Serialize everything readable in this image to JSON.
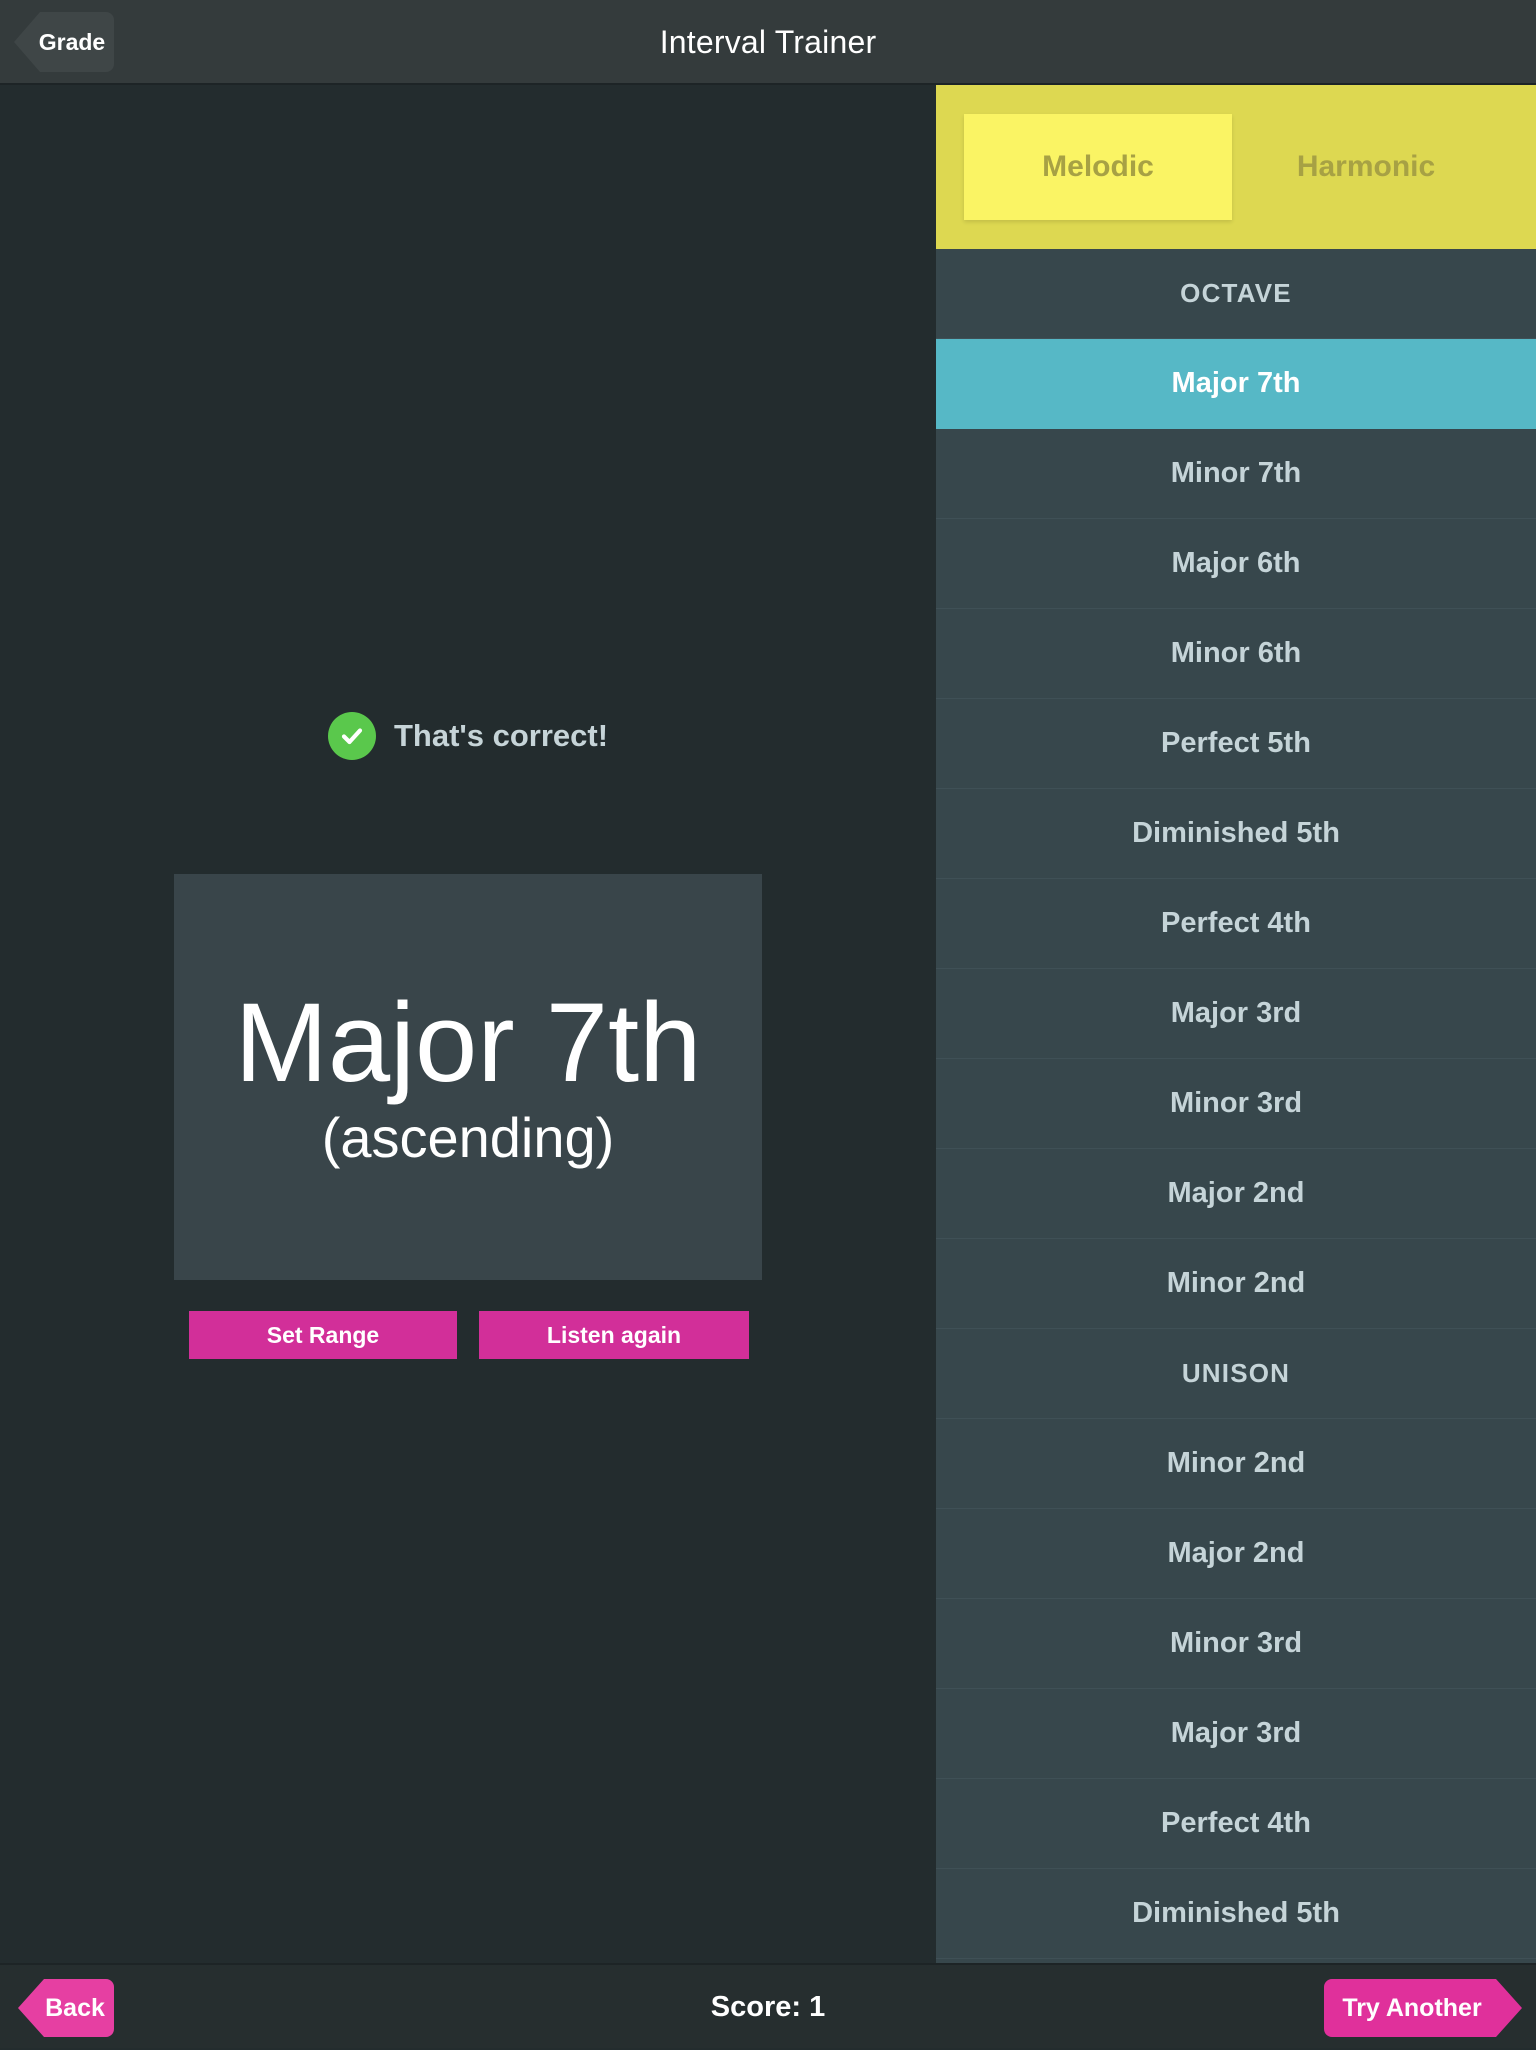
{
  "topbar": {
    "back_label": "Grade",
    "title": "Interval Trainer"
  },
  "feedback": {
    "icon": "check-circle-icon",
    "text": "That's correct!"
  },
  "answer_card": {
    "interval": "Major 7th",
    "direction": "(ascending)"
  },
  "actions": {
    "set_range_label": "Set Range",
    "listen_again_label": "Listen again"
  },
  "mode_toggle": {
    "options": [
      {
        "label": "Melodic",
        "selected": true
      },
      {
        "label": "Harmonic",
        "selected": false
      }
    ]
  },
  "interval_list": [
    {
      "label": "OCTAVE",
      "kind": "header",
      "selected": false
    },
    {
      "label": "Major 7th",
      "kind": "item",
      "selected": true
    },
    {
      "label": "Minor 7th",
      "kind": "item",
      "selected": false
    },
    {
      "label": "Major 6th",
      "kind": "item",
      "selected": false
    },
    {
      "label": "Minor 6th",
      "kind": "item",
      "selected": false
    },
    {
      "label": "Perfect 5th",
      "kind": "item",
      "selected": false
    },
    {
      "label": "Diminished 5th",
      "kind": "item",
      "selected": false
    },
    {
      "label": "Perfect 4th",
      "kind": "item",
      "selected": false
    },
    {
      "label": "Major 3rd",
      "kind": "item",
      "selected": false
    },
    {
      "label": "Minor 3rd",
      "kind": "item",
      "selected": false
    },
    {
      "label": "Major 2nd",
      "kind": "item",
      "selected": false
    },
    {
      "label": "Minor 2nd",
      "kind": "item",
      "selected": false
    },
    {
      "label": "UNISON",
      "kind": "header",
      "selected": false
    },
    {
      "label": "Minor 2nd",
      "kind": "item",
      "selected": false
    },
    {
      "label": "Major 2nd",
      "kind": "item",
      "selected": false
    },
    {
      "label": "Minor 3rd",
      "kind": "item",
      "selected": false
    },
    {
      "label": "Major 3rd",
      "kind": "item",
      "selected": false
    },
    {
      "label": "Perfect 4th",
      "kind": "item",
      "selected": false
    },
    {
      "label": "Diminished 5th",
      "kind": "item",
      "selected": false
    }
  ],
  "bottombar": {
    "back_label": "Back",
    "score_label": "Score: 1",
    "try_another_label": "Try Another"
  },
  "colors": {
    "page_background": "#232c2e",
    "bar_background": "#343b3c",
    "list_background": "#37474c",
    "selected_interval": "#56b8c6",
    "accent_pink": "#d22f99",
    "toggle_yellow": "#ddd851",
    "toggle_yellow_active": "#faf464",
    "correct_green": "#5ac84c",
    "card_background": "#39454a"
  }
}
